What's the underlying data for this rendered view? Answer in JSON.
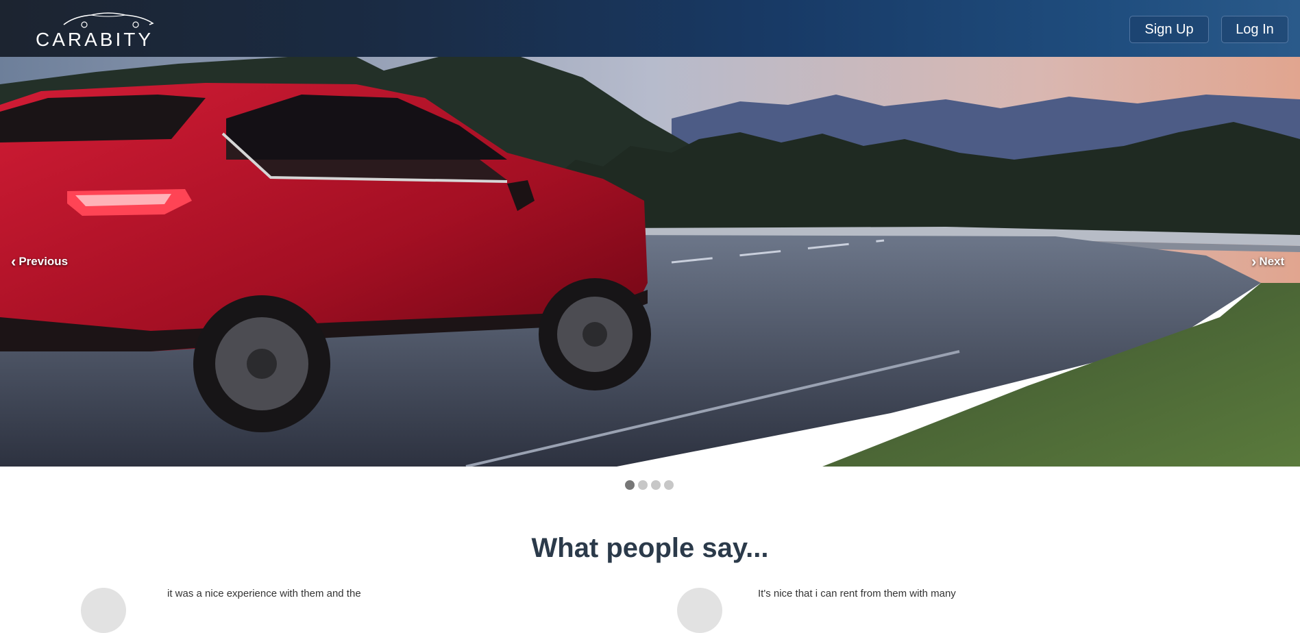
{
  "header": {
    "logo_text": "CARABITY",
    "signup_label": "Sign Up",
    "login_label": "Log In"
  },
  "carousel": {
    "prev_label": "Previous",
    "next_label": "Next",
    "slide_count": 4,
    "active_index": 0
  },
  "testimonials": {
    "title": "What people say...",
    "items": [
      {
        "text": "it was a nice experience with them and the"
      },
      {
        "text": "It's nice that i can rent from them with many"
      }
    ]
  },
  "colors": {
    "header_start": "#1c2430",
    "header_end": "#2a5a8a",
    "car_red": "#b3122a",
    "title_color": "#2b3a4a"
  },
  "icons": {
    "prev": "chevron-left-icon",
    "next": "chevron-right-icon"
  }
}
